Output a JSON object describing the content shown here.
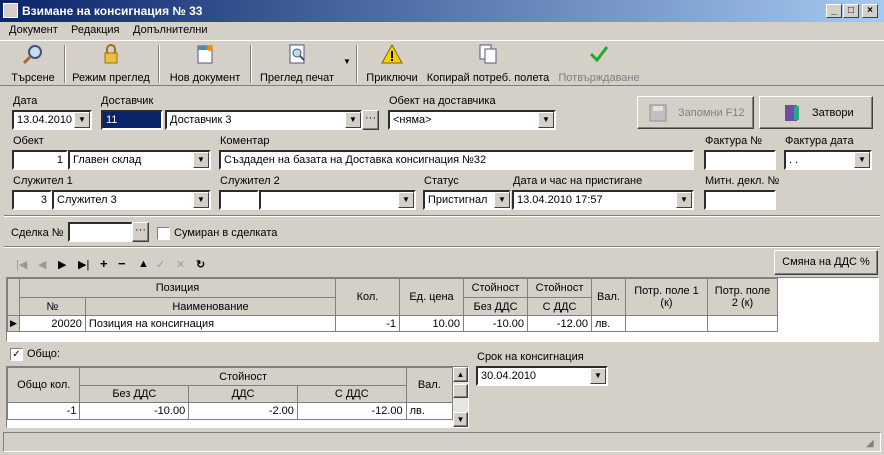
{
  "window": {
    "title": "Взимане на консигнация № 33"
  },
  "menu": [
    "Документ",
    "Редакция",
    "Допълнителни"
  ],
  "toolbar": {
    "search": "Търсене",
    "view_mode": "Режим преглед",
    "new_doc": "Нов документ",
    "print_preview": "Преглед печат",
    "finish": "Приключи",
    "copy_fields": "Копирай потреб. полета",
    "confirm": "Потвърждаване"
  },
  "form": {
    "date_label": "Дата",
    "date_value": "13.04.2010",
    "supplier_label": "Доставчик",
    "supplier_code": "11",
    "supplier_name": "Доставчик 3",
    "supplier_obj_label": "Обект на доставчика",
    "supplier_obj_value": "<няма>",
    "save_btn": "Запомни F12",
    "close_btn": "Затвори",
    "object_label": "Обект",
    "object_code": "1",
    "object_name": "Главен склад",
    "comment_label": "Коментар",
    "comment_value": "Създаден на базата на Доставка консигнация №32",
    "invoice_label": "Фактура №",
    "invoice_date_label": "Фактура дата",
    "invoice_date_value": ". .",
    "employee1_label": "Служител 1",
    "employee1_code": "3",
    "employee1_name": "Служител 3",
    "employee2_label": "Служител 2",
    "status_label": "Статус",
    "status_value": "Пристигнал",
    "arrival_label": "Дата и час на пристигане",
    "arrival_value": "13.04.2010 17:57",
    "customs_label": "Митн. декл. №",
    "deal_label": "Сделка №",
    "summed_label": "Сумиран в сделката",
    "vat_change_btn": "Смяна на ДДС %"
  },
  "grid": {
    "h_position": "Позиция",
    "h_no": "№",
    "h_name": "Наименование",
    "h_qty": "Кол.",
    "h_price": "Ед. цена",
    "h_value1": "Стойност",
    "h_value1_sub": "Без ДДС",
    "h_value2": "Стойност",
    "h_value2_sub": "С ДДС",
    "h_cur": "Вал.",
    "h_user1": "Потр. поле 1 (к)",
    "h_user2": "Потр. поле 2 (к)",
    "row": {
      "no": "20020",
      "name": "Позиция на консигнация",
      "qty": "-1",
      "price": "10.00",
      "value_no_vat": "-10.00",
      "value_vat": "-12.00",
      "cur": "лв."
    }
  },
  "totals": {
    "check_label": "Общо:",
    "h_qty": "Общо кол.",
    "h_value": "Стойност",
    "h_no_vat": "Без ДДС",
    "h_vat": "ДДС",
    "h_with_vat": "С ДДС",
    "h_cur": "Вал.",
    "qty": "-1",
    "no_vat": "-10.00",
    "vat": "-2.00",
    "with_vat": "-12.00",
    "cur": "лв.",
    "term_label": "Срок на консигнация",
    "term_value": "30.04.2010"
  }
}
